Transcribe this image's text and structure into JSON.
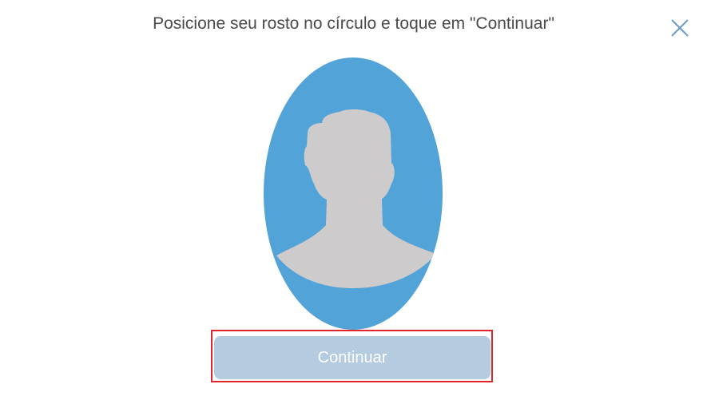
{
  "dialog": {
    "instruction": "Posicione seu rosto no círculo e toque em \"Continuar\"",
    "close_icon": "close-icon",
    "continue_label": "Continuar"
  },
  "colors": {
    "oval": "#52a3d8",
    "silhouette": "#cdcbcc",
    "button_disabled": "#b4cbe0",
    "close_icon": "#6a9cc4",
    "highlight": "#e0252b"
  },
  "icons": {
    "face_placeholder": "person-silhouette-icon"
  }
}
